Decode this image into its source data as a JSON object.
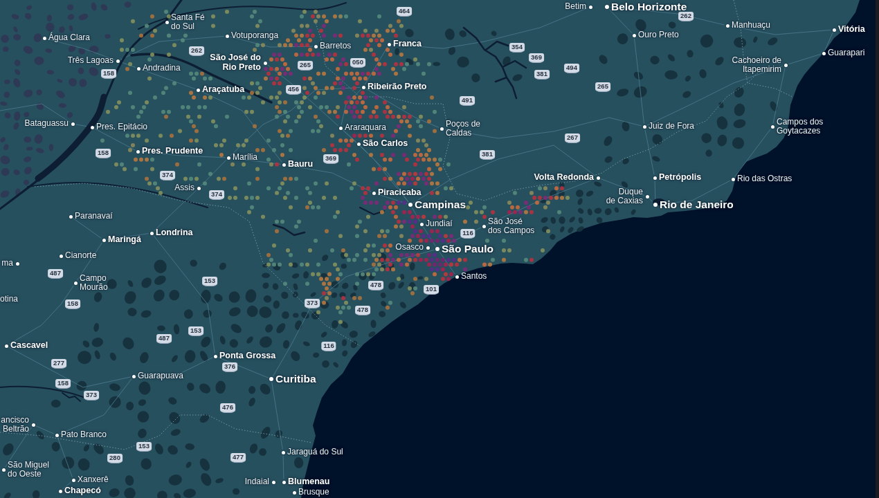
{
  "map": {
    "places": [
      {
        "lines": [
          "Betim"
        ],
        "kind": "town"
      },
      {
        "lines": [
          "Belo Horizonte"
        ],
        "kind": "major"
      },
      {
        "lines": [
          "Santa Fé",
          "do Sul"
        ],
        "kind": "town"
      },
      {
        "lines": [
          "Manhuaçu"
        ],
        "kind": "town"
      },
      {
        "lines": [
          "Água Clara"
        ],
        "kind": "town"
      },
      {
        "lines": [
          "Votuporanga"
        ],
        "kind": "town"
      },
      {
        "lines": [
          "Ouro Preto"
        ],
        "kind": "town"
      },
      {
        "lines": [
          "Vitória"
        ],
        "kind": "city"
      },
      {
        "lines": [
          "Barretos"
        ],
        "kind": "town"
      },
      {
        "lines": [
          "Franca"
        ],
        "kind": "city"
      },
      {
        "lines": [
          "Três Lagoas"
        ],
        "kind": "town"
      },
      {
        "lines": [
          "Andradina"
        ],
        "kind": "town"
      },
      {
        "lines": [
          "São José do",
          "Rio Preto"
        ],
        "kind": "city"
      },
      {
        "lines": [
          "Cachoeiro de",
          "Itapemirim"
        ],
        "kind": "town"
      },
      {
        "lines": [
          "Guarapari"
        ],
        "kind": "town"
      },
      {
        "lines": [
          "Araçatuba"
        ],
        "kind": "city"
      },
      {
        "lines": [
          "Ribeirão Preto"
        ],
        "kind": "city"
      },
      {
        "lines": [
          "Bataguassu"
        ],
        "kind": "town"
      },
      {
        "lines": [
          "Pres. Epitácio"
        ],
        "kind": "town"
      },
      {
        "lines": [
          "Araraquara"
        ],
        "kind": "town"
      },
      {
        "lines": [
          "Poços de",
          "Caldas"
        ],
        "kind": "town"
      },
      {
        "lines": [
          "Juiz de Fora"
        ],
        "kind": "town"
      },
      {
        "lines": [
          "Campos dos",
          "Goytacazes"
        ],
        "kind": "town"
      },
      {
        "lines": [
          "Pres. Prudente"
        ],
        "kind": "city"
      },
      {
        "lines": [
          "São Carlos"
        ],
        "kind": "city"
      },
      {
        "lines": [
          "Marília"
        ],
        "kind": "town"
      },
      {
        "lines": [
          "Bauru"
        ],
        "kind": "city"
      },
      {
        "lines": [
          "Volta Redonda"
        ],
        "kind": "city"
      },
      {
        "lines": [
          "Petrópolis"
        ],
        "kind": "city"
      },
      {
        "lines": [
          "Rio das Ostras"
        ],
        "kind": "town"
      },
      {
        "lines": [
          "Assis"
        ],
        "kind": "town"
      },
      {
        "lines": [
          "Piracicaba"
        ],
        "kind": "city"
      },
      {
        "lines": [
          "Campinas"
        ],
        "kind": "major"
      },
      {
        "lines": [
          "Duque",
          "de Caxias"
        ],
        "kind": "town"
      },
      {
        "lines": [
          "Rio de Janeiro"
        ],
        "kind": "major"
      },
      {
        "lines": [
          "Paranavaí"
        ],
        "kind": "town"
      },
      {
        "lines": [
          "Maringá"
        ],
        "kind": "city"
      },
      {
        "lines": [
          "Londrina"
        ],
        "kind": "city"
      },
      {
        "lines": [
          "Jundiaí"
        ],
        "kind": "town"
      },
      {
        "lines": [
          "São José",
          "dos Campos"
        ],
        "kind": "town"
      },
      {
        "lines": [
          "Cianorte"
        ],
        "kind": "town"
      },
      {
        "lines": [
          "Osasco"
        ],
        "kind": "town"
      },
      {
        "lines": [
          "São Paulo"
        ],
        "kind": "major"
      },
      {
        "lines": [
          "ma"
        ],
        "kind": "town"
      },
      {
        "lines": [
          "Campo",
          "Mourão"
        ],
        "kind": "town"
      },
      {
        "lines": [
          "Santos"
        ],
        "kind": "town"
      },
      {
        "lines": [
          "otina"
        ],
        "kind": "town"
      },
      {
        "lines": [
          "Cascavel"
        ],
        "kind": "city"
      },
      {
        "lines": [
          "Ponta Grossa"
        ],
        "kind": "city"
      },
      {
        "lines": [
          "Guarapuava"
        ],
        "kind": "town"
      },
      {
        "lines": [
          "Curitiba"
        ],
        "kind": "major"
      },
      {
        "lines": [
          "ancisco",
          "Beltrão"
        ],
        "kind": "town"
      },
      {
        "lines": [
          "Pato Branco"
        ],
        "kind": "town"
      },
      {
        "lines": [
          "Jaraguá do Sul"
        ],
        "kind": "town"
      },
      {
        "lines": [
          "São Miguel",
          "do Oeste"
        ],
        "kind": "town"
      },
      {
        "lines": [
          "Xanxerê"
        ],
        "kind": "town"
      },
      {
        "lines": [
          "Indaial"
        ],
        "kind": "town"
      },
      {
        "lines": [
          "Blumenau"
        ],
        "kind": "city"
      },
      {
        "lines": [
          "Chapecó"
        ],
        "kind": "city"
      },
      {
        "lines": [
          "Brusque"
        ],
        "kind": "town"
      }
    ],
    "route_shields": [
      "464",
      "262",
      "262",
      "354",
      "158",
      "265",
      "050",
      "369",
      "381",
      "494",
      "456",
      "265",
      "491",
      "267",
      "158",
      "369",
      "381",
      "374",
      "374",
      "116",
      "487",
      "153",
      "478",
      "101",
      "158",
      "373",
      "478",
      "487",
      "153",
      "116",
      "277",
      "376",
      "158",
      "373",
      "476",
      "153",
      "280",
      "477"
    ]
  }
}
